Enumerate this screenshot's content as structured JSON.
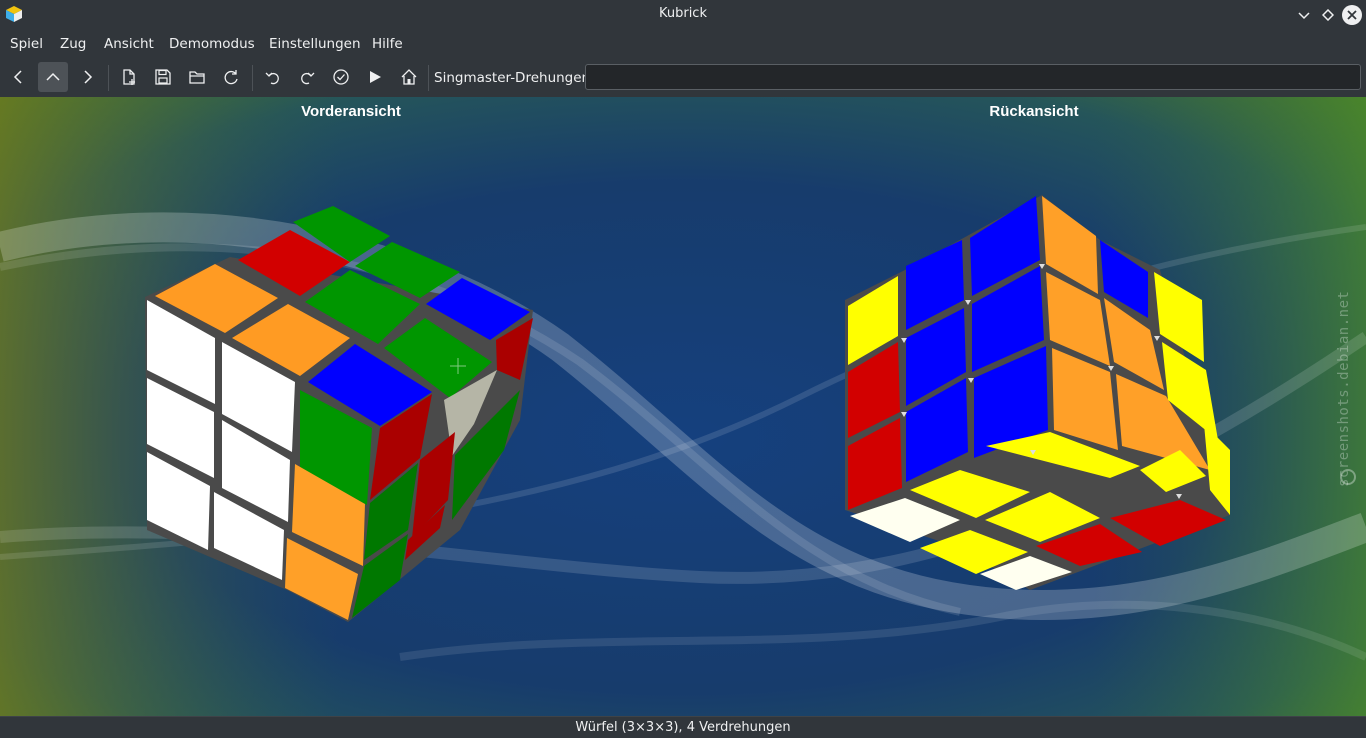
{
  "window": {
    "title": "Kubrick"
  },
  "menu": [
    "Spiel",
    "Zug",
    "Ansicht",
    "Demomodus",
    "Einstellungen",
    "Hilfe"
  ],
  "toolbar": {
    "singmaster_label": "Singmaster-Drehungen",
    "singmaster_value": "",
    "icons": [
      "chevron-left-icon",
      "chevron-up-icon",
      "chevron-right-icon",
      "new-document-icon",
      "save-icon",
      "open-folder-icon",
      "reload-icon",
      "undo-icon",
      "redo-icon",
      "check-icon",
      "play-icon",
      "home-icon"
    ]
  },
  "views": {
    "front_label": "Vorderansicht",
    "back_label": "Rückansicht"
  },
  "watermark": "screenshots.debian.net",
  "status": {
    "text": "Würfel (3×3×3), 4 Verdrehungen"
  },
  "colors": {
    "accent": "#3daee9",
    "window_bg": "#31363b",
    "cube_white": "#ffffff",
    "cube_orange": "#ffa028",
    "cube_green": "#009600",
    "cube_blue": "#0000ff",
    "cube_red": "#d20000",
    "cube_yellow": "#ffff00"
  }
}
